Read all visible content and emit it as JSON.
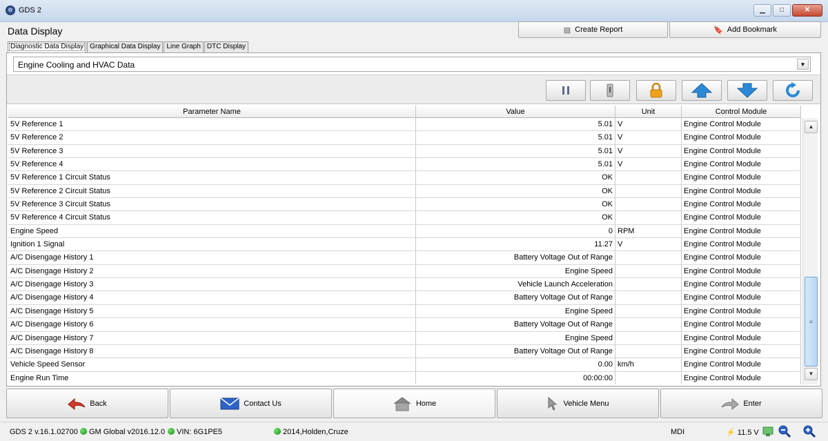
{
  "window": {
    "title": "GDS 2",
    "app_icon": "gds-logo-icon"
  },
  "header": {
    "page_title": "Data Display",
    "create_report_label": "Create Report",
    "add_bookmark_label": "Add Bookmark"
  },
  "tabs": [
    {
      "label": "Diagnostic Data Display",
      "active": true
    },
    {
      "label": "Graphical Data Display",
      "active": false
    },
    {
      "label": "Line Graph",
      "active": false
    },
    {
      "label": "DTC Display",
      "active": false
    }
  ],
  "data_list": {
    "selected": "Engine Cooling and HVAC Data"
  },
  "toolbar": {
    "icons": [
      "pause-icon",
      "snapshot-icon",
      "lock-icon",
      "arrow-up-icon",
      "arrow-down-icon",
      "refresh-icon"
    ],
    "accent_colors": {
      "lock": "#f0a31a",
      "arrows": "#2b8ad8"
    }
  },
  "table": {
    "columns": [
      "Parameter Name",
      "Value",
      "Unit",
      "Control Module"
    ],
    "rows": [
      {
        "name": "5V Reference 1",
        "value": "5.01",
        "unit": "V",
        "module": "Engine Control Module"
      },
      {
        "name": "5V Reference 2",
        "value": "5.01",
        "unit": "V",
        "module": "Engine Control Module"
      },
      {
        "name": "5V Reference 3",
        "value": "5.01",
        "unit": "V",
        "module": "Engine Control Module"
      },
      {
        "name": "5V Reference 4",
        "value": "5.01",
        "unit": "V",
        "module": "Engine Control Module"
      },
      {
        "name": "5V Reference 1 Circuit Status",
        "value": "OK",
        "unit": "",
        "module": "Engine Control Module"
      },
      {
        "name": "5V Reference 2 Circuit Status",
        "value": "OK",
        "unit": "",
        "module": "Engine Control Module"
      },
      {
        "name": "5V Reference 3 Circuit Status",
        "value": "OK",
        "unit": "",
        "module": "Engine Control Module"
      },
      {
        "name": "5V Reference 4 Circuit Status",
        "value": "OK",
        "unit": "",
        "module": "Engine Control Module"
      },
      {
        "name": "Engine Speed",
        "value": "0",
        "unit": "RPM",
        "module": "Engine Control Module"
      },
      {
        "name": "Ignition 1 Signal",
        "value": "11.27",
        "unit": "V",
        "module": "Engine Control Module"
      },
      {
        "name": "A/C Disengage History 1",
        "value": "Battery Voltage Out of Range",
        "unit": "",
        "module": "Engine Control Module"
      },
      {
        "name": "A/C Disengage History 2",
        "value": "Engine Speed",
        "unit": "",
        "module": "Engine Control Module"
      },
      {
        "name": "A/C Disengage History 3",
        "value": "Vehicle Launch Acceleration",
        "unit": "",
        "module": "Engine Control Module"
      },
      {
        "name": "A/C Disengage History 4",
        "value": "Battery Voltage Out of Range",
        "unit": "",
        "module": "Engine Control Module"
      },
      {
        "name": "A/C Disengage History 5",
        "value": "Engine Speed",
        "unit": "",
        "module": "Engine Control Module"
      },
      {
        "name": "A/C Disengage History 6",
        "value": "Battery Voltage Out of Range",
        "unit": "",
        "module": "Engine Control Module"
      },
      {
        "name": "A/C Disengage History 7",
        "value": "Engine Speed",
        "unit": "",
        "module": "Engine Control Module"
      },
      {
        "name": "A/C Disengage History 8",
        "value": "Battery Voltage Out of Range",
        "unit": "",
        "module": "Engine Control Module"
      },
      {
        "name": "Vehicle Speed Sensor",
        "value": "0.00",
        "unit": "km/h",
        "module": "Engine Control Module"
      },
      {
        "name": "Engine Run Time",
        "value": "00:00:00",
        "unit": "",
        "module": "Engine Control Module"
      }
    ]
  },
  "nav": {
    "back_label": "Back",
    "contact_label": "Contact Us",
    "home_label": "Home",
    "vehicle_menu_label": "Vehicle Menu",
    "enter_label": "Enter"
  },
  "status": {
    "version": "GDS 2 v.16.1.02700",
    "global": "GM Global v2016.12.0",
    "vin": "VIN: 6G1PE5",
    "vehicle": "2014,Holden,Cruze",
    "mode": "MDI",
    "battery": "11.5 V"
  }
}
